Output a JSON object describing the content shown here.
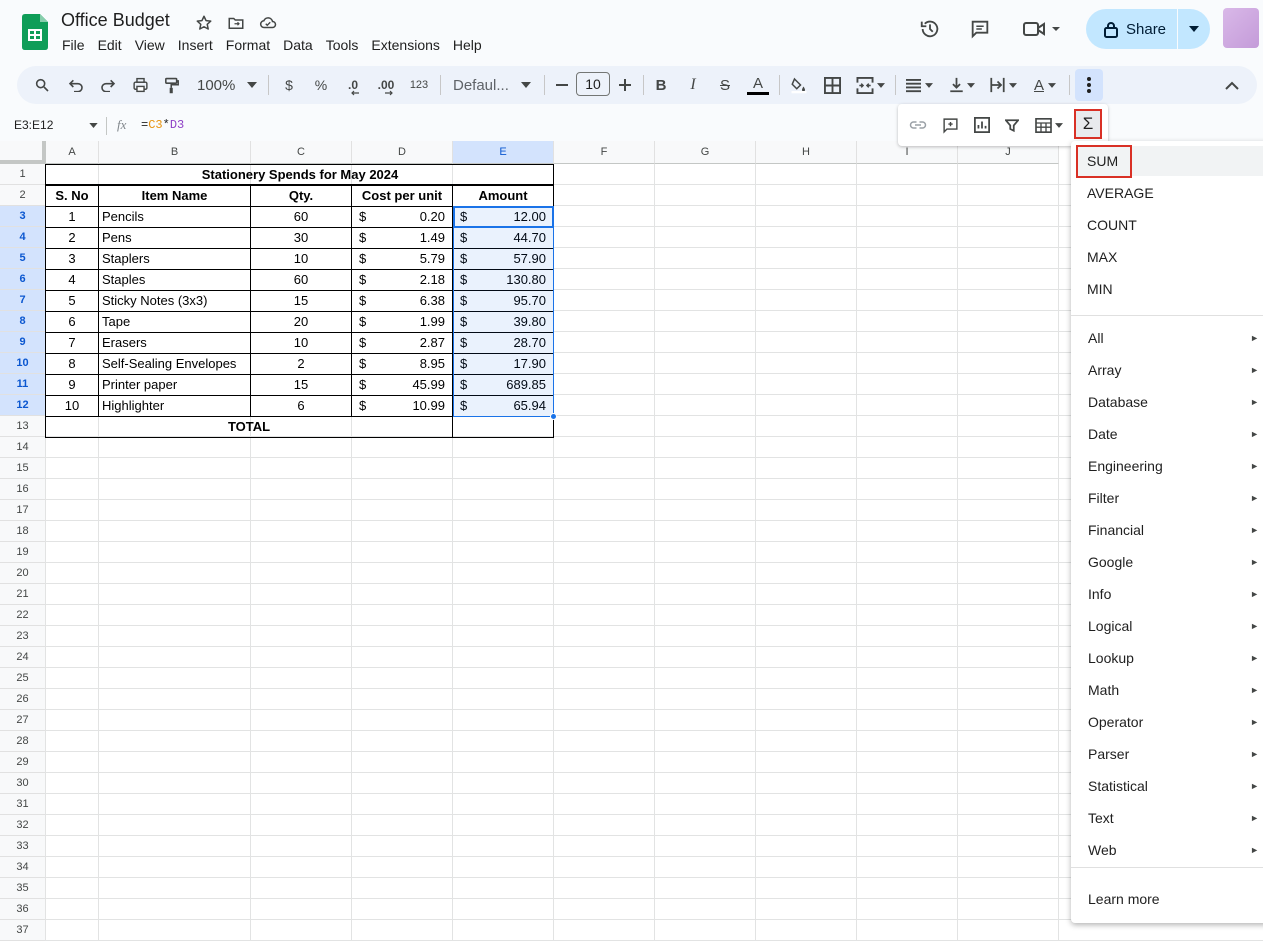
{
  "doc": {
    "title": "Office Budget"
  },
  "menubar": [
    "File",
    "Edit",
    "View",
    "Insert",
    "Format",
    "Data",
    "Tools",
    "Extensions",
    "Help"
  ],
  "share": {
    "label": "Share"
  },
  "toolbar": {
    "zoom": "100%",
    "currency": "$",
    "percent": "%",
    "dec_less": ".0",
    "dec_more": ".00",
    "number_format": "123",
    "font": "Defaul...",
    "font_size": "10"
  },
  "formula_bar": {
    "name_box": "E3:E12",
    "fx": "fx",
    "formula": {
      "eq": "=",
      "ref1": "C3",
      "op": "*",
      "ref2": "D3"
    }
  },
  "sigma": "Σ",
  "columns": [
    "A",
    "B",
    "C",
    "D",
    "E",
    "F",
    "G",
    "H",
    "I",
    "J"
  ],
  "rows": [
    "1",
    "2",
    "3",
    "4",
    "5",
    "6",
    "7",
    "8",
    "9",
    "10",
    "11",
    "12",
    "13",
    "14",
    "15",
    "16",
    "17",
    "18",
    "19",
    "20",
    "21",
    "22",
    "23",
    "24",
    "25",
    "26",
    "27",
    "28",
    "29",
    "30",
    "31",
    "32",
    "33",
    "34",
    "35",
    "36",
    "37"
  ],
  "sheet": {
    "title": "Stationery Spends for May 2024",
    "headers": [
      "S. No",
      "Item Name",
      "Qty.",
      "Cost per unit",
      "Amount"
    ],
    "rows": [
      [
        "1",
        "Pencils",
        "60",
        "0.20",
        "12.00"
      ],
      [
        "2",
        "Pens",
        "30",
        "1.49",
        "44.70"
      ],
      [
        "3",
        "Staplers",
        "10",
        "5.79",
        "57.90"
      ],
      [
        "4",
        "Staples",
        "60",
        "2.18",
        "130.80"
      ],
      [
        "5",
        "Sticky Notes (3x3)",
        "15",
        "6.38",
        "95.70"
      ],
      [
        "6",
        "Tape",
        "20",
        "1.99",
        "39.80"
      ],
      [
        "7",
        "Erasers",
        "10",
        "2.87",
        "28.70"
      ],
      [
        "8",
        "Self-Sealing Envelopes",
        "2",
        "8.95",
        "17.90"
      ],
      [
        "9",
        "Printer paper",
        "15",
        "45.99",
        "689.85"
      ],
      [
        "10",
        "Highlighter",
        "6",
        "10.99",
        "65.94"
      ]
    ],
    "currency_symbol": "$",
    "total_label": "TOTAL"
  },
  "function_menu": {
    "quick": [
      "SUM",
      "AVERAGE",
      "COUNT",
      "MAX",
      "MIN"
    ],
    "categories": [
      "All",
      "Array",
      "Database",
      "Date",
      "Engineering",
      "Filter",
      "Financial",
      "Google",
      "Info",
      "Logical",
      "Lookup",
      "Math",
      "Operator",
      "Parser",
      "Statistical",
      "Text",
      "Web"
    ],
    "arrow": "►",
    "learn_more": "Learn more"
  },
  "colors": {
    "accent": "#0b57d0",
    "highlight_border": "#d93025",
    "share_bg": "#c2e7ff",
    "sheets_green": "#0f9d58"
  }
}
